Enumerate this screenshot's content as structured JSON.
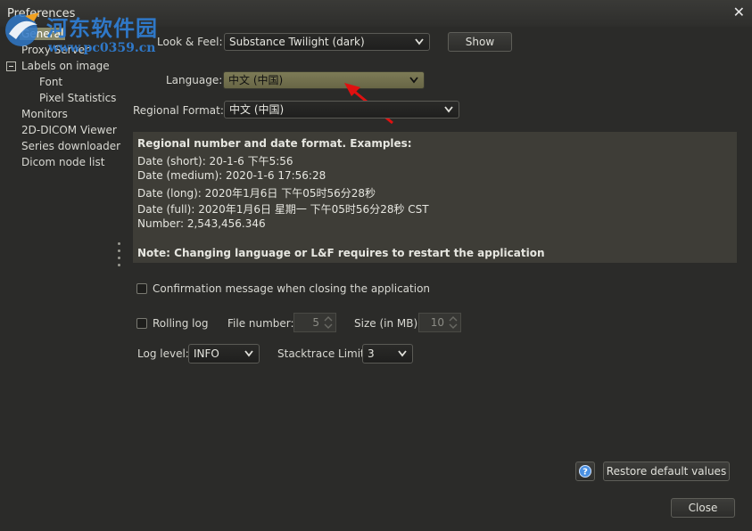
{
  "window": {
    "title": "Preferences"
  },
  "watermark": {
    "name": "河东软件园",
    "url": "www.pc0359.cn"
  },
  "sidebar": {
    "items": [
      {
        "label": "General",
        "selected": true
      },
      {
        "label": "Proxy Server"
      },
      {
        "label": "Labels on image",
        "expanded": true
      },
      {
        "label": "Font"
      },
      {
        "label": "Pixel Statistics"
      },
      {
        "label": "Monitors"
      },
      {
        "label": "2D-DICOM Viewer"
      },
      {
        "label": "Series downloader"
      },
      {
        "label": "Dicom node list"
      }
    ]
  },
  "general": {
    "look_feel_label": "Look & Feel:",
    "look_feel_value": "Substance Twilight (dark)",
    "show_button": "Show",
    "language_label": "Language:",
    "language_value": "中文 (中国)",
    "regional_label": "Regional Format:",
    "regional_value": "中文 (中国)",
    "examples": {
      "heading": "Regional number and date format. Examples:",
      "date_short": "Date (short): 20-1-6 下午5:56",
      "date_medium": "Date (medium): 2020-1-6 17:56:28",
      "date_long": "Date (long): 2020年1月6日 下午05时56分28秒",
      "date_full": "Date (full): 2020年1月6日 星期一 下午05时56分28秒 CST",
      "number": "Number: 2,543,456.346",
      "note": "Note: Changing language or L&F requires to restart the application"
    },
    "confirm_label": "Confirmation message when closing the application",
    "rolling_log_label": "Rolling log",
    "file_number_label": "File number:",
    "file_number_value": "5",
    "size_label": "Size (in MB):",
    "size_value": "10",
    "log_level_label": "Log level:",
    "log_level_value": "INFO",
    "stacktrace_label": "Stacktrace Limit:",
    "stacktrace_value": "3"
  },
  "footer": {
    "restore_button": "Restore default values",
    "close_button": "Close"
  },
  "colors": {
    "background": "#2b2b29",
    "highlight_combo": "#7d7b56",
    "info_panel": "#3e3d37",
    "arrow": "#e01010",
    "watermark": "#2f78c8"
  },
  "icons": [
    "close-icon",
    "collapse-icon",
    "chevron-down-icon",
    "help-icon",
    "spinner-arrows-icon",
    "red-arrow-annotation"
  ]
}
